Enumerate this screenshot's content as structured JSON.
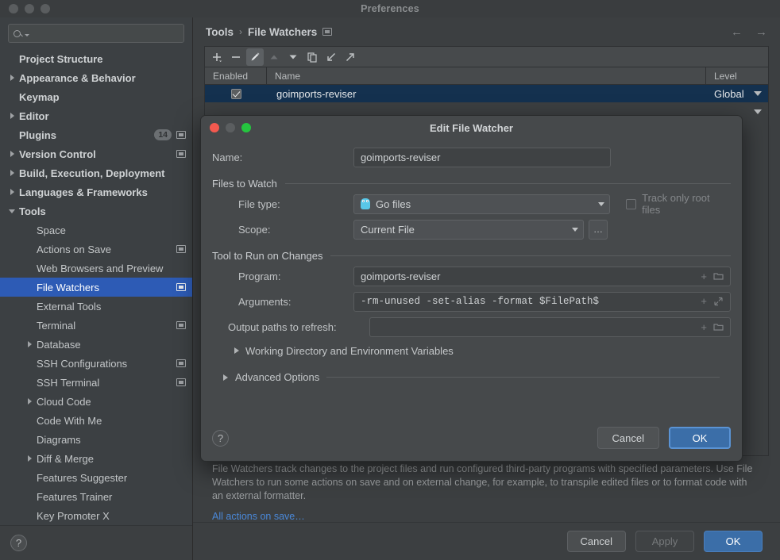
{
  "window": {
    "title": "Preferences"
  },
  "search": {
    "placeholder": "",
    "value": "",
    "icon": "search-icon"
  },
  "sidebar": {
    "items": [
      {
        "label": "Project Structure",
        "depth": 0,
        "twisty": "none",
        "bold": true,
        "badge": null,
        "trailing": null
      },
      {
        "label": "Appearance & Behavior",
        "depth": 0,
        "twisty": "closed",
        "bold": true,
        "badge": null,
        "trailing": null
      },
      {
        "label": "Keymap",
        "depth": 0,
        "twisty": "none",
        "bold": true,
        "badge": null,
        "trailing": null
      },
      {
        "label": "Editor",
        "depth": 0,
        "twisty": "closed",
        "bold": true,
        "badge": null,
        "trailing": null
      },
      {
        "label": "Plugins",
        "depth": 0,
        "twisty": "none",
        "bold": true,
        "badge": "14",
        "trailing": "project-icon"
      },
      {
        "label": "Version Control",
        "depth": 0,
        "twisty": "closed",
        "bold": true,
        "badge": null,
        "trailing": "project-icon"
      },
      {
        "label": "Build, Execution, Deployment",
        "depth": 0,
        "twisty": "closed",
        "bold": true,
        "badge": null,
        "trailing": null
      },
      {
        "label": "Languages & Frameworks",
        "depth": 0,
        "twisty": "closed",
        "bold": true,
        "badge": null,
        "trailing": null
      },
      {
        "label": "Tools",
        "depth": 0,
        "twisty": "open",
        "bold": true,
        "badge": null,
        "trailing": null
      },
      {
        "label": "Space",
        "depth": 1,
        "twisty": "none",
        "bold": false,
        "badge": null,
        "trailing": null
      },
      {
        "label": "Actions on Save",
        "depth": 1,
        "twisty": "none",
        "bold": false,
        "badge": null,
        "trailing": "project-icon"
      },
      {
        "label": "Web Browsers and Preview",
        "depth": 1,
        "twisty": "none",
        "bold": false,
        "badge": null,
        "trailing": null
      },
      {
        "label": "File Watchers",
        "depth": 1,
        "twisty": "none",
        "bold": false,
        "badge": null,
        "trailing": "project-icon",
        "selected": true
      },
      {
        "label": "External Tools",
        "depth": 1,
        "twisty": "none",
        "bold": false,
        "badge": null,
        "trailing": null
      },
      {
        "label": "Terminal",
        "depth": 1,
        "twisty": "none",
        "bold": false,
        "badge": null,
        "trailing": "project-icon"
      },
      {
        "label": "Database",
        "depth": 1,
        "twisty": "closed",
        "bold": false,
        "badge": null,
        "trailing": null
      },
      {
        "label": "SSH Configurations",
        "depth": 1,
        "twisty": "none",
        "bold": false,
        "badge": null,
        "trailing": "project-icon"
      },
      {
        "label": "SSH Terminal",
        "depth": 1,
        "twisty": "none",
        "bold": false,
        "badge": null,
        "trailing": "project-icon"
      },
      {
        "label": "Cloud Code",
        "depth": 1,
        "twisty": "closed",
        "bold": false,
        "badge": null,
        "trailing": null
      },
      {
        "label": "Code With Me",
        "depth": 1,
        "twisty": "none",
        "bold": false,
        "badge": null,
        "trailing": null
      },
      {
        "label": "Diagrams",
        "depth": 1,
        "twisty": "none",
        "bold": false,
        "badge": null,
        "trailing": null
      },
      {
        "label": "Diff & Merge",
        "depth": 1,
        "twisty": "closed",
        "bold": false,
        "badge": null,
        "trailing": null
      },
      {
        "label": "Features Suggester",
        "depth": 1,
        "twisty": "none",
        "bold": false,
        "badge": null,
        "trailing": null
      },
      {
        "label": "Features Trainer",
        "depth": 1,
        "twisty": "none",
        "bold": false,
        "badge": null,
        "trailing": null
      },
      {
        "label": "Key Promoter X",
        "depth": 1,
        "twisty": "none",
        "bold": false,
        "badge": null,
        "trailing": null
      }
    ],
    "help_label": "?"
  },
  "breadcrumb": {
    "root": "Tools",
    "separator": "›",
    "current": "File Watchers",
    "back_icon": "←",
    "forward_icon": "→"
  },
  "toolbar": {
    "add": "+",
    "remove": "−",
    "edit": "pencil-icon",
    "move_up": "▲",
    "move_down": "▼",
    "copy": "copy-icon",
    "import": "import-icon",
    "export": "export-icon"
  },
  "table": {
    "columns": [
      "Enabled",
      "Name",
      "Level"
    ],
    "rows": [
      {
        "enabled": true,
        "name": "goimports-reviser",
        "level": "Global",
        "selected": true
      }
    ]
  },
  "description": {
    "text": "File Watchers track changes to the project files and run configured third-party programs with specified parameters. Use File Watchers to run some actions on save and on external change, for example, to transpile edited files or to format code with an external formatter.",
    "link": "All actions on save…"
  },
  "footer": {
    "cancel": "Cancel",
    "apply": "Apply",
    "ok": "OK"
  },
  "dialog": {
    "title": "Edit File Watcher",
    "name_label": "Name:",
    "name_value": "goimports-reviser",
    "files_section": "Files to Watch",
    "file_type_label": "File type:",
    "file_type_value": "Go files",
    "file_type_icon": "go-gopher-icon",
    "track_only_root_label": "Track only root files",
    "track_only_root_checked": false,
    "scope_label": "Scope:",
    "scope_value": "Current File",
    "scope_browse": "…",
    "tool_section": "Tool to Run on Changes",
    "program_label": "Program:",
    "program_value": "goimports-reviser",
    "arguments_label": "Arguments:",
    "arguments_value": "-rm-unused -set-alias -format $FilePath$",
    "output_label": "Output paths to refresh:",
    "output_value": "",
    "working_dir_label": "Working Directory and Environment Variables",
    "advanced_label": "Advanced Options",
    "help_label": "?",
    "cancel": "Cancel",
    "ok": "OK"
  },
  "colors": {
    "accent_blue": "#3b6ea8",
    "selection_blue": "#2d5bb5",
    "row_selection": "#14314f",
    "link_blue": "#4a88d8",
    "window_bg": "#3c3f41",
    "dialog_bg": "#46494b",
    "gopher_blue": "#59c7e8"
  }
}
